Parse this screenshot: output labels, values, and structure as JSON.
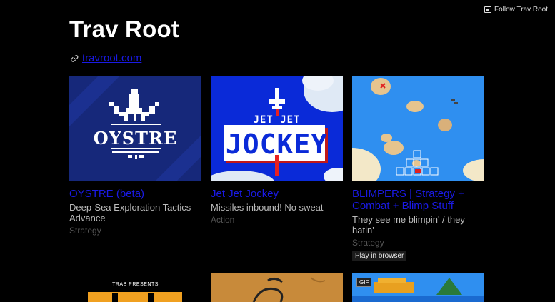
{
  "header": {
    "follow_label": "Follow Trav Root",
    "title": "Trav Root",
    "site_link": "travroot.com"
  },
  "games": [
    {
      "title": "OYSTRE (beta)",
      "description": "Deep-Sea Exploration Tactics Advance",
      "genre": "Strategy",
      "cover_text": "OYSTRE"
    },
    {
      "title": "Jet Jet Jockey",
      "description": "Missiles inbound! No sweat",
      "genre": "Action",
      "cover_text_top": "JET JET",
      "cover_text_bottom": "JOCKEY"
    },
    {
      "title": "BLIMPERS | Strategy + Combat + Blimp Stuff",
      "description": "They see me blimpin' / they hatin'",
      "genre": "Strategy",
      "play_label": "Play in browser"
    },
    {
      "cover_text": "TRAB PRESENTS"
    },
    {},
    {
      "gif_badge": "GIF"
    }
  ],
  "colors": {
    "link": "#1a1ae6",
    "oystre_bg": "#16287a",
    "jet_bg": "#0a2ad8",
    "blimpers_sea": "#2f8ff0"
  }
}
